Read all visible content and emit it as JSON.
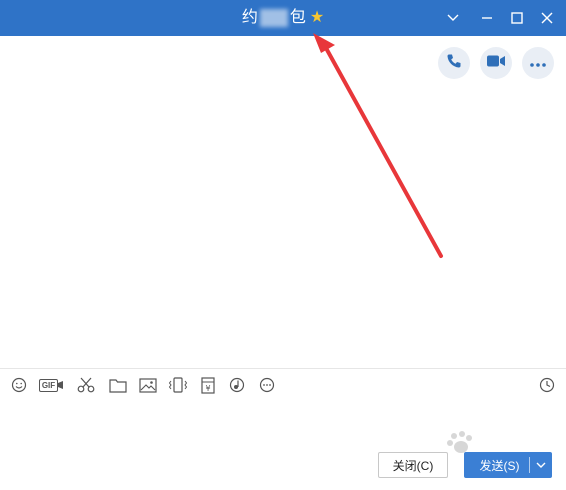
{
  "window": {
    "title_start": "约",
    "title_end": "包",
    "favorite_icon": "star-icon",
    "favorite_color": "#f7c631",
    "controls": [
      "chevron-down-icon",
      "minimize-icon",
      "maximize-icon",
      "close-icon"
    ]
  },
  "header_actions": [
    "phone-icon",
    "video-call-icon",
    "more-icon"
  ],
  "toolbar": {
    "gif_label": "GIF",
    "icons": [
      "emoji-icon",
      "gif-icon",
      "screenshot-scissors-icon",
      "folder-icon",
      "image-icon",
      "shake-window-icon",
      "red-packet-icon",
      "music-icon",
      "more-tools-icon",
      "history-clock-icon"
    ]
  },
  "buttons": {
    "close_label": "关闭(C)",
    "send_label": "发送(S)"
  },
  "colors": {
    "titlebar": "#2f73c7",
    "accent": "#3b7fd4",
    "annotation_arrow": "#e8373a"
  }
}
